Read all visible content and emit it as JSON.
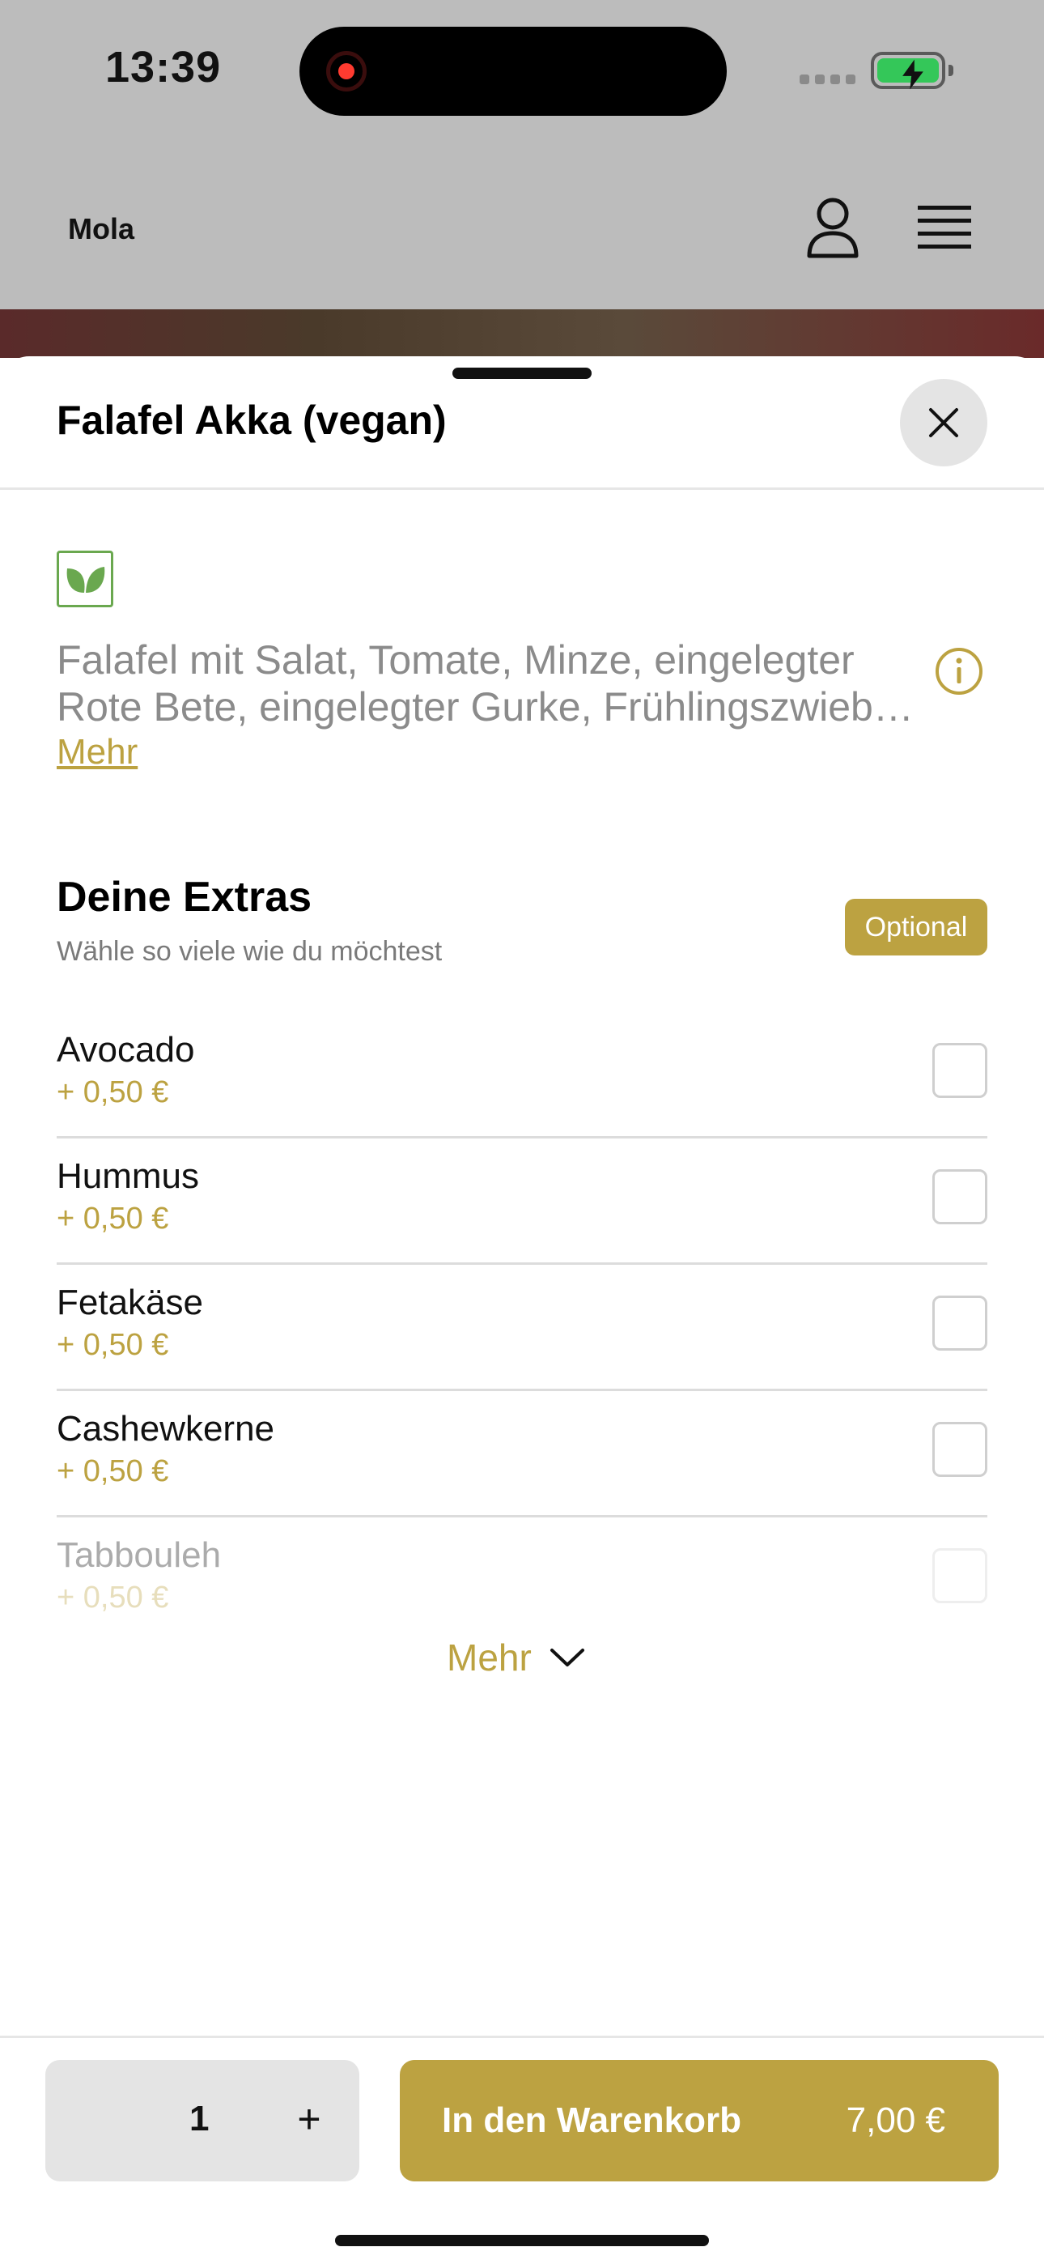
{
  "status_bar": {
    "time": "13:39"
  },
  "app_header": {
    "brand": "Mola"
  },
  "sheet": {
    "title": "Falafel Akka (vegan)",
    "description_lines": [
      "Falafel mit Salat, Tomate, Minze, eingelegter",
      "Rote Bete, eingelegter Gurke, Frühlingszwieb…"
    ],
    "more_link": "Mehr"
  },
  "extras": {
    "title": "Deine Extras",
    "subtitle": "Wähle so viele wie du möchtest",
    "badge": "Optional",
    "items": [
      {
        "name": "Avocado",
        "price": "+ 0,50 €"
      },
      {
        "name": "Hummus",
        "price": "+ 0,50 €"
      },
      {
        "name": "Fetakäse",
        "price": "+ 0,50 €"
      },
      {
        "name": "Cashewkerne",
        "price": "+ 0,50 €"
      },
      {
        "name": "Tabbouleh",
        "price": "+ 0,50 €"
      }
    ],
    "more_toggle": "Mehr"
  },
  "footer": {
    "quantity": "1",
    "plus": "+",
    "cart_label": "In den Warenkorb",
    "cart_price": "7,00 €"
  },
  "colors": {
    "accent": "#bca241",
    "veg_green": "#6aa84f",
    "battery_green": "#34c759"
  }
}
